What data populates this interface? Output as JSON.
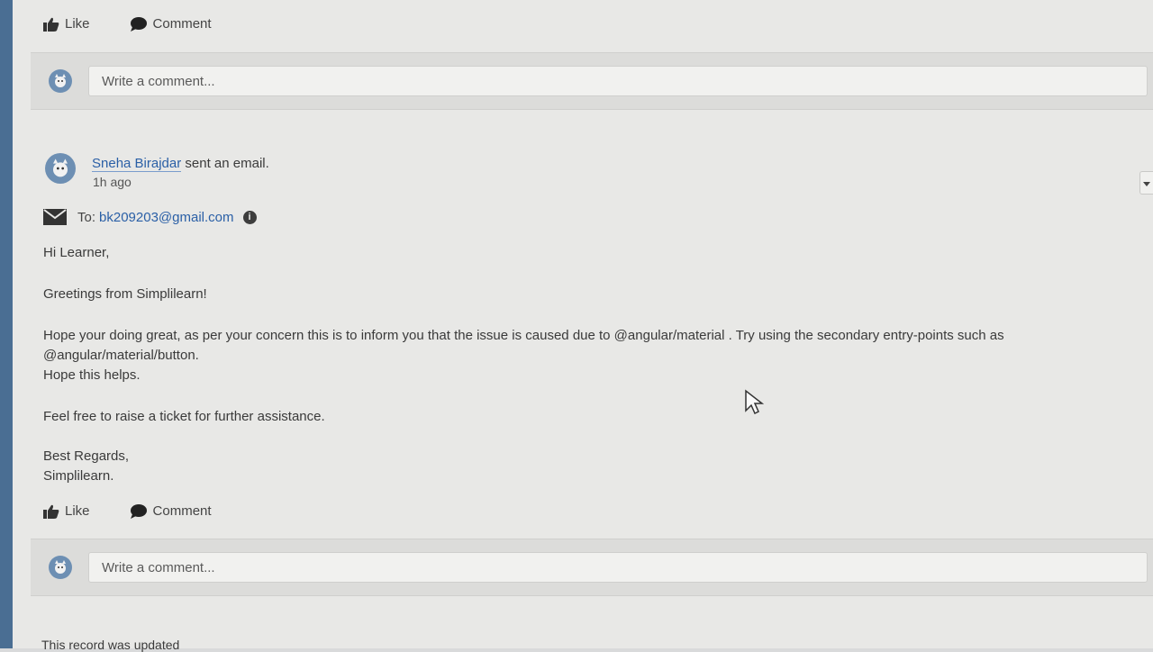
{
  "top_actions": {
    "like": "Like",
    "comment": "Comment"
  },
  "comment_box_top": {
    "placeholder": "Write a comment..."
  },
  "post": {
    "author": "Sneha Birajdar",
    "action": "sent an email.",
    "time": "1h ago",
    "to_label": "To:",
    "to_email": "bk209203@gmail.com",
    "info_icon": "i",
    "greeting": "Hi Learner,",
    "line_greetings": "Greetings from Simplilearn!",
    "para_1": "Hope your doing great, as per your concern this is to inform you that the issue is caused due to @angular/material . Try using the secondary entry-points such as",
    "para_2": "@angular/material/button.",
    "para_3": "Hope this helps.",
    "line_ticket": "Feel free to raise a ticket for further assistance.",
    "signoff_1": "Best Regards,",
    "signoff_2": "Simplilearn."
  },
  "bottom_actions": {
    "like": "Like",
    "comment": "Comment"
  },
  "comment_box_bottom": {
    "placeholder": "Write a comment..."
  },
  "footer_note": "This record was updated",
  "icons": [
    "like-icon",
    "comment-bubble-icon",
    "avatar-icon",
    "envelope-icon",
    "info-icon",
    "dropdown-arrow-icon",
    "mouse-cursor-icon"
  ],
  "colors": {
    "link": "#2a5fa6",
    "avatar": "#6d8fb3",
    "background": "#e8e8e6"
  }
}
